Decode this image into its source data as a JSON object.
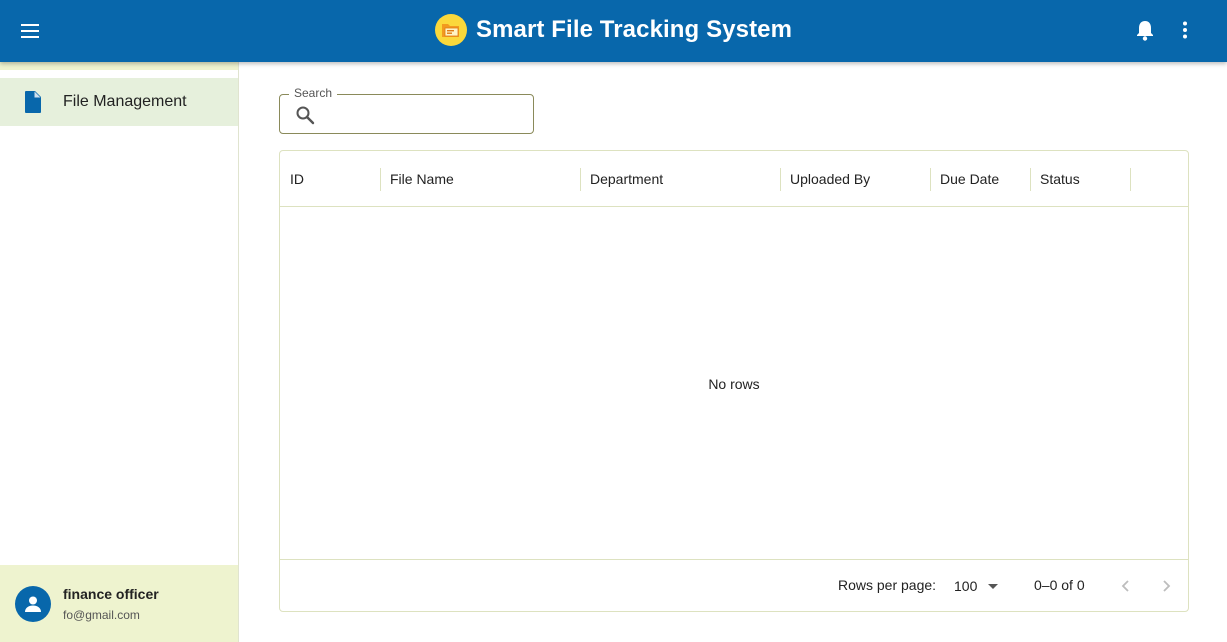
{
  "app": {
    "title": "Smart File Tracking System"
  },
  "icons": {
    "menu": "menu-icon",
    "logo": "folder-logo-icon",
    "notifications": "bell-icon",
    "more": "more-vert-icon",
    "file": "file-icon",
    "user": "person-icon",
    "search": "search-icon",
    "dropdown": "arrow-drop-down-icon",
    "prev": "chevron-left-icon",
    "next": "chevron-right-icon"
  },
  "colors": {
    "appbar": "#0867ab",
    "accent_light": "#eef3cf",
    "selected_nav": "#e6f0dc",
    "logo": "#fbd83b"
  },
  "sidebar": {
    "items": [
      {
        "label": "File Management",
        "selected": true
      }
    ],
    "user": {
      "name": "finance officer",
      "email": "fo@gmail.com"
    }
  },
  "search": {
    "label": "Search",
    "value": "",
    "placeholder": ""
  },
  "table": {
    "columns": [
      "ID",
      "File Name",
      "Department",
      "Uploaded By",
      "Due Date",
      "Status"
    ],
    "rows": [],
    "empty_message": "No rows",
    "footer": {
      "rows_per_page_label": "Rows per page:",
      "rows_per_page_value": "100",
      "range_text": "0–0 of 0"
    }
  }
}
